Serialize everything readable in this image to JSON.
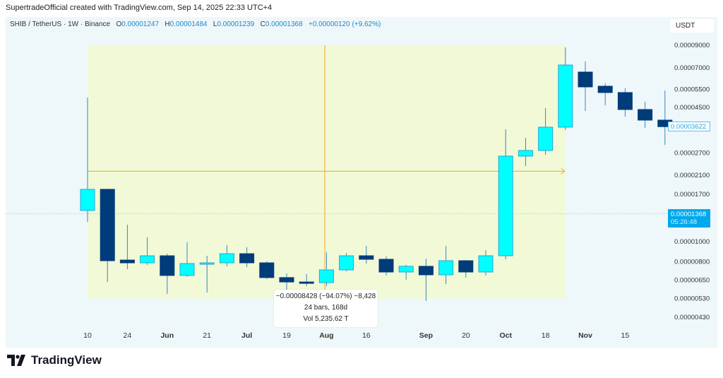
{
  "credit": "SupertradeOfficial created with TradingView.com, Sep 14, 2025 22:33 UTC+4",
  "legend": {
    "symbol": "SHIB / TetherUS · 1W · Binance",
    "o_label": "O",
    "o": "0.00001247",
    "h_label": "H",
    "h": "0.00001484",
    "l_label": "L",
    "l": "0.00001239",
    "c_label": "C",
    "c": "0.00001368",
    "change": "+0.00000120 (+9.62%)"
  },
  "currency": "USDT",
  "current_price": {
    "value": "0.00001368",
    "countdown": "05:26:48"
  },
  "last_visible_price": "0.00003622",
  "measure_tooltip": {
    "line1": "−0.00008428 (−94.07%) −8,428",
    "line2": "24 bars, 168d",
    "line3": "Vol 5,235.62 T"
  },
  "brand": "TradingView",
  "colors": {
    "up": "#00ffff",
    "down": "#003b7a",
    "wick": "#3a86c0",
    "range_fill": "#f1f9d6",
    "measure_line": "#f5a623",
    "price_line": "#00a9ec"
  },
  "chart_data": {
    "type": "candlestick",
    "scale": "log",
    "ylim": [
      4e-06,
      9.5e-06
    ],
    "y_ticks": [
      "0.00009000",
      "0.00007000",
      "0.00005500",
      "0.00004500",
      "0.00002700",
      "0.00002100",
      "0.00001700",
      "0.00001000",
      "0.00000800",
      "0.00000650",
      "0.00000530",
      "0.00000430"
    ],
    "x_ticks": [
      {
        "label": "10",
        "bar": 0,
        "bold": false
      },
      {
        "label": "24",
        "bar": 2,
        "bold": false
      },
      {
        "label": "Jun",
        "bar": 4,
        "bold": true
      },
      {
        "label": "21",
        "bar": 6,
        "bold": false
      },
      {
        "label": "Jul",
        "bar": 8,
        "bold": true
      },
      {
        "label": "19",
        "bar": 10,
        "bold": false
      },
      {
        "label": "Aug",
        "bar": 12,
        "bold": true
      },
      {
        "label": "16",
        "bar": 14,
        "bold": false
      },
      {
        "label": "Sep",
        "bar": 17,
        "bold": true
      },
      {
        "label": "20",
        "bar": 19,
        "bold": false
      },
      {
        "label": "Oct",
        "bar": 21,
        "bold": true
      },
      {
        "label": "18",
        "bar": 23,
        "bold": false
      },
      {
        "label": "Nov",
        "bar": 25,
        "bold": true
      },
      {
        "label": "15",
        "bar": 27,
        "bold": false
      }
    ],
    "candles": [
      [
        1.418e-05,
        5.017e-05,
        1.249e-05,
        1.797e-05
      ],
      [
        1.797e-05,
        1.811e-05,
        6.38e-06,
        8.09e-06
      ],
      [
        8.15e-06,
        1.21e-05,
        7.36e-06,
        7.9e-06
      ],
      [
        7.9e-06,
        1.05e-05,
        7.72e-06,
        8.55e-06
      ],
      [
        8.55e-06,
        8.75e-06,
        5.58e-06,
        6.86e-06
      ],
      [
        6.86e-06,
        9.94e-06,
        6.75e-06,
        7.84e-06
      ],
      [
        7.78e-06,
        8.55e-06,
        5.67e-06,
        7.9e-06
      ],
      [
        7.9e-06,
        9.63e-06,
        7.6e-06,
        8.75e-06
      ],
      [
        8.75e-06,
        9.41e-06,
        7.54e-06,
        7.9e-06
      ],
      [
        7.9e-06,
        8.03e-06,
        6.59e-06,
        6.7e-06
      ],
      [
        6.7e-06,
        7.02e-06,
        5.76e-06,
        6.38e-06
      ],
      [
        6.38e-06,
        6.96e-06,
        6.09e-06,
        6.28e-06
      ],
      [
        6.33e-06,
        8.89e-06,
        6.09e-06,
        7.3e-06
      ],
      [
        7.3e-06,
        8.82e-06,
        7.19e-06,
        8.55e-06
      ],
      [
        8.55e-06,
        9.55e-06,
        7.84e-06,
        8.22e-06
      ],
      [
        8.22e-06,
        8.48e-06,
        6.86e-06,
        7.13e-06
      ],
      [
        7.13e-06,
        7.72e-06,
        6.54e-06,
        7.6e-06
      ],
      [
        7.6e-06,
        8.28e-06,
        5.16e-06,
        6.91e-06
      ],
      [
        6.91e-06,
        9.55e-06,
        6.23e-06,
        8.09e-06
      ],
      [
        8.09e-06,
        8.15e-06,
        6.7e-06,
        7.13e-06
      ],
      [
        7.13e-06,
        9.11e-06,
        6.86e-06,
        8.55e-06
      ],
      [
        8.55e-06,
        3.515e-05,
        8.22e-06,
        2.605e-05
      ],
      [
        2.605e-05,
        3.198e-05,
        2.332e-05,
        2.774e-05
      ],
      [
        2.774e-05,
        4.456e-05,
        2.646e-05,
        3.6e-05
      ],
      [
        3.6e-05,
        8.789e-05,
        3.488e-05,
        7.214e-05
      ],
      [
        6.666e-05,
        7.505e-05,
        4.317e-05,
        5.648e-05
      ],
      [
        5.692e-05,
        5.875e-05,
        4.599e-05,
        5.302e-05
      ],
      [
        5.302e-05,
        5.559e-05,
        4.053e-05,
        4.386e-05
      ],
      [
        4.386e-05,
        4.784e-05,
        3.572e-05,
        3.896e-05
      ],
      [
        3.896e-05,
        5.429e-05,
        2.955e-05,
        3.622e-05
      ]
    ],
    "measure_range": {
      "start_bar": 0,
      "end_bar": 24,
      "high": 9e-05,
      "low": 5.3e-06,
      "target_price": 2.2e-05
    }
  }
}
